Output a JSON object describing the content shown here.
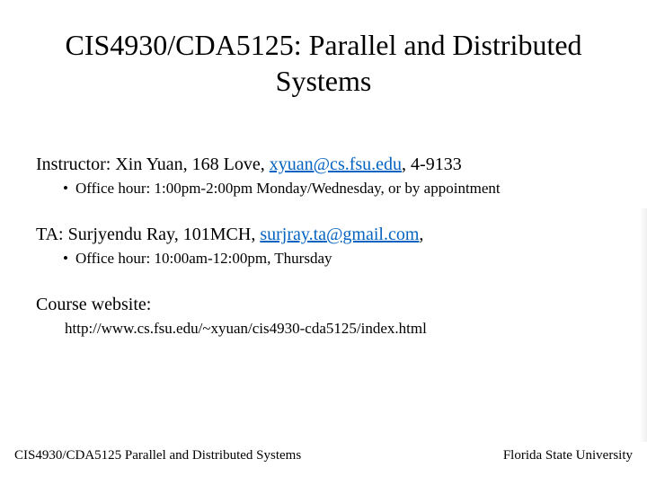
{
  "title": "CIS4930/CDA5125: Parallel and Distributed Systems",
  "instructor": {
    "prefix": "Instructor: Xin Yuan, 168 Love, ",
    "email": "xyuan@cs.fsu.edu",
    "suffix": ", 4-9133",
    "office_hours": "Office hour: 1:00pm-2:00pm Monday/Wednesday, or by appointment"
  },
  "ta": {
    "prefix": "TA: Surjyendu Ray, 101MCH, ",
    "email": "surjray.ta@gmail.com",
    "suffix": ",",
    "office_hours": "Office hour: 10:00am-12:00pm, Thursday"
  },
  "website": {
    "label": "Course website:",
    "url": "http://www.cs.fsu.edu/~xyuan/cis4930-cda5125/index.html"
  },
  "footer": {
    "left": "CIS4930/CDA5125 Parallel and Distributed Systems",
    "right": "Florida State University"
  }
}
